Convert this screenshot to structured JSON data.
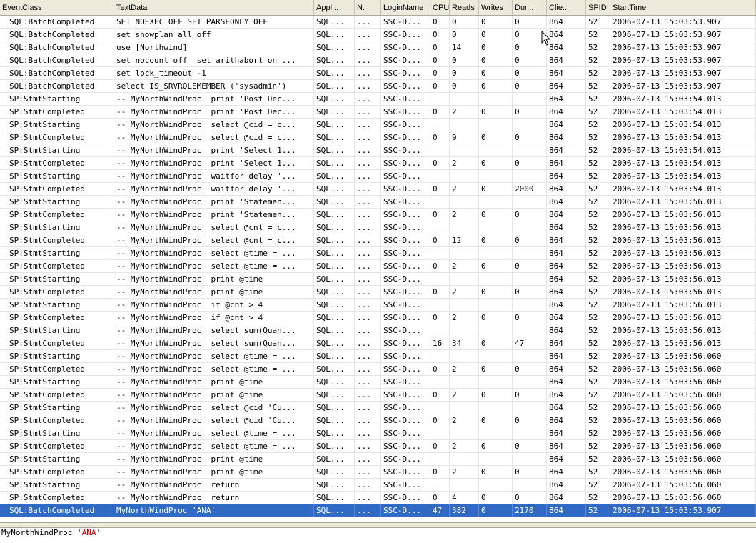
{
  "columns": [
    {
      "key": "event",
      "label": "EventClass"
    },
    {
      "key": "text",
      "label": "TextData"
    },
    {
      "key": "app",
      "label": "Appl..."
    },
    {
      "key": "n",
      "label": "N..."
    },
    {
      "key": "login",
      "label": "LoginName"
    },
    {
      "key": "cpu",
      "label": "CPU"
    },
    {
      "key": "reads",
      "label": "Reads"
    },
    {
      "key": "writes",
      "label": "Writes"
    },
    {
      "key": "dur",
      "label": "Dur..."
    },
    {
      "key": "client",
      "label": "Clie..."
    },
    {
      "key": "spid",
      "label": "SPID"
    },
    {
      "key": "start",
      "label": "StartTime"
    }
  ],
  "rows": [
    [
      "SQL:BatchCompleted",
      "SET NOEXEC OFF SET PARSEONLY OFF",
      "SQL...",
      "...",
      "SSC-D...",
      "0",
      "0",
      "0",
      "0",
      "864",
      "52",
      "2006-07-13 15:03:53.907"
    ],
    [
      "SQL:BatchCompleted",
      "set showplan_all off",
      "SQL...",
      "...",
      "SSC-D...",
      "0",
      "0",
      "0",
      "0",
      "864",
      "52",
      "2006-07-13 15:03:53.907"
    ],
    [
      "SQL:BatchCompleted",
      "use [Northwind]",
      "SQL...",
      "...",
      "SSC-D...",
      "0",
      "14",
      "0",
      "0",
      "864",
      "52",
      "2006-07-13 15:03:53.907"
    ],
    [
      "SQL:BatchCompleted",
      "set nocount off  set arithabort on ...",
      "SQL...",
      "...",
      "SSC-D...",
      "0",
      "0",
      "0",
      "0",
      "864",
      "52",
      "2006-07-13 15:03:53.907"
    ],
    [
      "SQL:BatchCompleted",
      "set lock_timeout -1",
      "SQL...",
      "...",
      "SSC-D...",
      "0",
      "0",
      "0",
      "0",
      "864",
      "52",
      "2006-07-13 15:03:53.907"
    ],
    [
      "SQL:BatchCompleted",
      "select IS_SRVROLEMEMBER ('sysadmin')",
      "SQL...",
      "...",
      "SSC-D...",
      "0",
      "0",
      "0",
      "0",
      "864",
      "52",
      "2006-07-13 15:03:53.907"
    ],
    [
      "SP:StmtStarting",
      "-- MyNorthWindProc  print 'Post Dec...",
      "SQL...",
      "...",
      "SSC-D...",
      "",
      "",
      "",
      "",
      "864",
      "52",
      "2006-07-13 15:03:54.013"
    ],
    [
      "SP:StmtCompleted",
      "-- MyNorthWindProc  print 'Post Dec...",
      "SQL...",
      "...",
      "SSC-D...",
      "0",
      "2",
      "0",
      "0",
      "864",
      "52",
      "2006-07-13 15:03:54.013"
    ],
    [
      "SP:StmtStarting",
      "-- MyNorthWindProc  select @cid = c...",
      "SQL...",
      "...",
      "SSC-D...",
      "",
      "",
      "",
      "",
      "864",
      "52",
      "2006-07-13 15:03:54.013"
    ],
    [
      "SP:StmtCompleted",
      "-- MyNorthWindProc  select @cid = c...",
      "SQL...",
      "...",
      "SSC-D...",
      "0",
      "9",
      "0",
      "0",
      "864",
      "52",
      "2006-07-13 15:03:54.013"
    ],
    [
      "SP:StmtStarting",
      "-- MyNorthWindProc  print 'Select 1...",
      "SQL...",
      "...",
      "SSC-D...",
      "",
      "",
      "",
      "",
      "864",
      "52",
      "2006-07-13 15:03:54.013"
    ],
    [
      "SP:StmtCompleted",
      "-- MyNorthWindProc  print 'Select 1...",
      "SQL...",
      "...",
      "SSC-D...",
      "0",
      "2",
      "0",
      "0",
      "864",
      "52",
      "2006-07-13 15:03:54.013"
    ],
    [
      "SP:StmtStarting",
      "-- MyNorthWindProc  waitfor delay '...",
      "SQL...",
      "...",
      "SSC-D...",
      "",
      "",
      "",
      "",
      "864",
      "52",
      "2006-07-13 15:03:54.013"
    ],
    [
      "SP:StmtCompleted",
      "-- MyNorthWindProc  waitfor delay '...",
      "SQL...",
      "...",
      "SSC-D...",
      "0",
      "2",
      "0",
      "2000",
      "864",
      "52",
      "2006-07-13 15:03:54.013"
    ],
    [
      "SP:StmtStarting",
      "-- MyNorthWindProc  print 'Statemen...",
      "SQL...",
      "...",
      "SSC-D...",
      "",
      "",
      "",
      "",
      "864",
      "52",
      "2006-07-13 15:03:56.013"
    ],
    [
      "SP:StmtCompleted",
      "-- MyNorthWindProc  print 'Statemen...",
      "SQL...",
      "...",
      "SSC-D...",
      "0",
      "2",
      "0",
      "0",
      "864",
      "52",
      "2006-07-13 15:03:56.013"
    ],
    [
      "SP:StmtStarting",
      "-- MyNorthWindProc  select @cnt = c...",
      "SQL...",
      "...",
      "SSC-D...",
      "",
      "",
      "",
      "",
      "864",
      "52",
      "2006-07-13 15:03:56.013"
    ],
    [
      "SP:StmtCompleted",
      "-- MyNorthWindProc  select @cnt = c...",
      "SQL...",
      "...",
      "SSC-D...",
      "0",
      "12",
      "0",
      "0",
      "864",
      "52",
      "2006-07-13 15:03:56.013"
    ],
    [
      "SP:StmtStarting",
      "-- MyNorthWindProc  select @time = ...",
      "SQL...",
      "...",
      "SSC-D...",
      "",
      "",
      "",
      "",
      "864",
      "52",
      "2006-07-13 15:03:56.013"
    ],
    [
      "SP:StmtCompleted",
      "-- MyNorthWindProc  select @time = ...",
      "SQL...",
      "...",
      "SSC-D...",
      "0",
      "2",
      "0",
      "0",
      "864",
      "52",
      "2006-07-13 15:03:56.013"
    ],
    [
      "SP:StmtStarting",
      "-- MyNorthWindProc  print @time",
      "SQL...",
      "...",
      "SSC-D...",
      "",
      "",
      "",
      "",
      "864",
      "52",
      "2006-07-13 15:03:56.013"
    ],
    [
      "SP:StmtCompleted",
      "-- MyNorthWindProc  print @time",
      "SQL...",
      "...",
      "SSC-D...",
      "0",
      "2",
      "0",
      "0",
      "864",
      "52",
      "2006-07-13 15:03:56.013"
    ],
    [
      "SP:StmtStarting",
      "-- MyNorthWindProc  if @cnt > 4",
      "SQL...",
      "...",
      "SSC-D...",
      "",
      "",
      "",
      "",
      "864",
      "52",
      "2006-07-13 15:03:56.013"
    ],
    [
      "SP:StmtCompleted",
      "-- MyNorthWindProc  if @cnt > 4",
      "SQL...",
      "...",
      "SSC-D...",
      "0",
      "2",
      "0",
      "0",
      "864",
      "52",
      "2006-07-13 15:03:56.013"
    ],
    [
      "SP:StmtStarting",
      "-- MyNorthWindProc  select sum(Quan...",
      "SQL...",
      "...",
      "SSC-D...",
      "",
      "",
      "",
      "",
      "864",
      "52",
      "2006-07-13 15:03:56.013"
    ],
    [
      "SP:StmtCompleted",
      "-- MyNorthWindProc  select sum(Quan...",
      "SQL...",
      "...",
      "SSC-D...",
      "16",
      "34",
      "0",
      "47",
      "864",
      "52",
      "2006-07-13 15:03:56.013"
    ],
    [
      "SP:StmtStarting",
      "-- MyNorthWindProc  select @time = ...",
      "SQL...",
      "...",
      "SSC-D...",
      "",
      "",
      "",
      "",
      "864",
      "52",
      "2006-07-13 15:03:56.060"
    ],
    [
      "SP:StmtCompleted",
      "-- MyNorthWindProc  select @time = ...",
      "SQL...",
      "...",
      "SSC-D...",
      "0",
      "2",
      "0",
      "0",
      "864",
      "52",
      "2006-07-13 15:03:56.060"
    ],
    [
      "SP:StmtStarting",
      "-- MyNorthWindProc  print @time",
      "SQL...",
      "...",
      "SSC-D...",
      "",
      "",
      "",
      "",
      "864",
      "52",
      "2006-07-13 15:03:56.060"
    ],
    [
      "SP:StmtCompleted",
      "-- MyNorthWindProc  print @time",
      "SQL...",
      "...",
      "SSC-D...",
      "0",
      "2",
      "0",
      "0",
      "864",
      "52",
      "2006-07-13 15:03:56.060"
    ],
    [
      "SP:StmtStarting",
      "-- MyNorthWindProc  select @cid 'Cu...",
      "SQL...",
      "...",
      "SSC-D...",
      "",
      "",
      "",
      "",
      "864",
      "52",
      "2006-07-13 15:03:56.060"
    ],
    [
      "SP:StmtCompleted",
      "-- MyNorthWindProc  select @cid 'Cu...",
      "SQL...",
      "...",
      "SSC-D...",
      "0",
      "2",
      "0",
      "0",
      "864",
      "52",
      "2006-07-13 15:03:56.060"
    ],
    [
      "SP:StmtStarting",
      "-- MyNorthWindProc  select @time = ...",
      "SQL...",
      "...",
      "SSC-D...",
      "",
      "",
      "",
      "",
      "864",
      "52",
      "2006-07-13 15:03:56.060"
    ],
    [
      "SP:StmtCompleted",
      "-- MyNorthWindProc  select @time = ...",
      "SQL...",
      "...",
      "SSC-D...",
      "0",
      "2",
      "0",
      "0",
      "864",
      "52",
      "2006-07-13 15:03:56.060"
    ],
    [
      "SP:StmtStarting",
      "-- MyNorthWindProc  print @time",
      "SQL...",
      "...",
      "SSC-D...",
      "",
      "",
      "",
      "",
      "864",
      "52",
      "2006-07-13 15:03:56.060"
    ],
    [
      "SP:StmtCompleted",
      "-- MyNorthWindProc  print @time",
      "SQL...",
      "...",
      "SSC-D...",
      "0",
      "2",
      "0",
      "0",
      "864",
      "52",
      "2006-07-13 15:03:56.060"
    ],
    [
      "SP:StmtStarting",
      "-- MyNorthWindProc  return",
      "SQL...",
      "...",
      "SSC-D...",
      "",
      "",
      "",
      "",
      "864",
      "52",
      "2006-07-13 15:03:56.060"
    ],
    [
      "SP:StmtCompleted",
      "-- MyNorthWindProc  return",
      "SQL...",
      "...",
      "SSC-D...",
      "0",
      "4",
      "0",
      "0",
      "864",
      "52",
      "2006-07-13 15:03:56.060"
    ],
    [
      "SQL:BatchCompleted",
      "MyNorthWindProc 'ANA'",
      "SQL...",
      "...",
      "SSC-D...",
      "47",
      "382",
      "0",
      "2170",
      "864",
      "52",
      "2006-07-13 15:03:53.907"
    ]
  ],
  "selected_row": 38,
  "details": {
    "proc": "MyNorthWindProc ",
    "arg": "'ANA'"
  },
  "colors": {
    "selection": "#316ac5",
    "header_bg": "#ebeadb",
    "string_literal": "#cc0000"
  },
  "icons": {
    "cursor": "mouse-pointer-icon"
  }
}
